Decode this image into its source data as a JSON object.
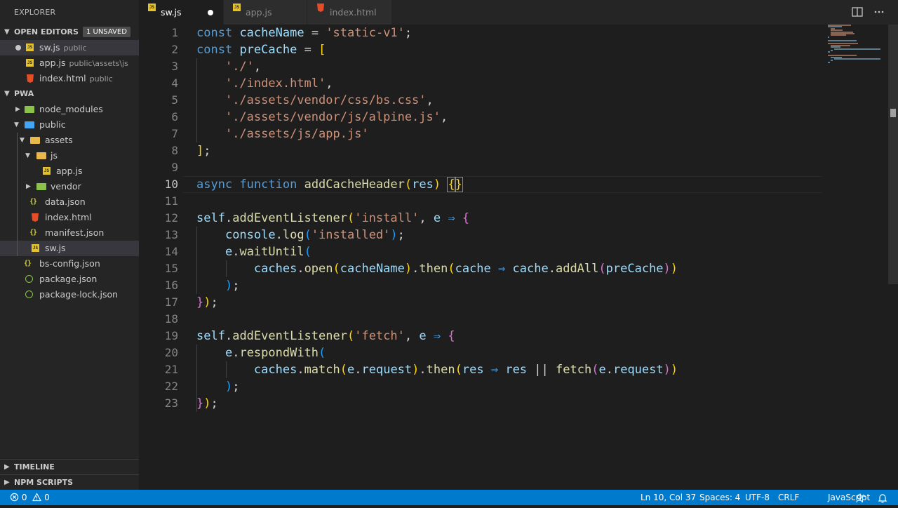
{
  "sidebar": {
    "title": "EXPLORER",
    "open_editors": {
      "title": "OPEN EDITORS",
      "badge": "1 UNSAVED",
      "items": [
        {
          "name": "sw.js",
          "desc": "public",
          "icon": "js-file-icon",
          "unsaved": true
        },
        {
          "name": "app.js",
          "desc": "public\\assets\\js",
          "icon": "js-file-icon"
        },
        {
          "name": "index.html",
          "desc": "public",
          "icon": "html-file-icon"
        }
      ]
    },
    "project": {
      "title": "PWA",
      "tree": [
        {
          "name": "node_modules",
          "type": "folder",
          "icon": "node-folder-icon"
        },
        {
          "name": "public",
          "type": "folder",
          "icon": "public-folder-icon"
        },
        {
          "name": "assets",
          "type": "folder",
          "icon": "folder-icon"
        },
        {
          "name": "js",
          "type": "folder",
          "icon": "folder-icon"
        },
        {
          "name": "app.js",
          "type": "file",
          "icon": "js-file-icon"
        },
        {
          "name": "vendor",
          "type": "folder",
          "icon": "vendor-folder-icon"
        },
        {
          "name": "data.json",
          "type": "file",
          "icon": "json-file-icon"
        },
        {
          "name": "index.html",
          "type": "file",
          "icon": "html-file-icon"
        },
        {
          "name": "manifest.json",
          "type": "file",
          "icon": "json-file-icon"
        },
        {
          "name": "sw.js",
          "type": "file",
          "icon": "js-file-icon"
        },
        {
          "name": "bs-config.json",
          "type": "file",
          "icon": "json-file-icon"
        },
        {
          "name": "package.json",
          "type": "file",
          "icon": "npm-file-icon"
        },
        {
          "name": "package-lock.json",
          "type": "file",
          "icon": "npm-file-icon"
        }
      ]
    },
    "timeline": "TIMELINE",
    "npm_scripts": "NPM SCRIPTS"
  },
  "tabs": [
    {
      "label": "sw.js",
      "active": true,
      "unsaved": true
    },
    {
      "label": "app.js"
    },
    {
      "label": "index.html"
    }
  ],
  "editor": {
    "line_numbers": [
      "1",
      "2",
      "3",
      "4",
      "5",
      "6",
      "7",
      "8",
      "9",
      "10",
      "11",
      "12",
      "13",
      "14",
      "15",
      "16",
      "17",
      "18",
      "19",
      "20",
      "21",
      "22",
      "23"
    ],
    "current_line": 10,
    "code": [
      "const cacheName = 'static-v1';",
      "const preCache = [",
      "    './',",
      "    './index.html',",
      "    './assets/vendor/css/bs.css',",
      "    './assets/vendor/js/alpine.js',",
      "    './assets/js/app.js'",
      "];",
      "",
      "async function addCacheHeader(res) {}",
      "",
      "self.addEventListener('install', e => {",
      "    console.log('installed');",
      "    e.waitUntil(",
      "        caches.open(cacheName).then(cache => cache.addAll(preCache))",
      "    );",
      "});",
      "",
      "self.addEventListener('fetch', e => {",
      "    e.respondWith(",
      "        caches.match(e.request).then(res => res || fetch(e.request))",
      "    );",
      "});"
    ]
  },
  "statusbar": {
    "errors": "0",
    "warnings": "0",
    "position": "Ln 10, Col 37",
    "spaces": "Spaces: 4",
    "encoding": "UTF-8",
    "eol": "CRLF",
    "language": "JavaScript"
  },
  "colors": {
    "statusbar": "#007acc",
    "keyword": "#569cd6",
    "string": "#ce9178",
    "function": "#dcdcaa",
    "variable": "#9cdcfe"
  }
}
